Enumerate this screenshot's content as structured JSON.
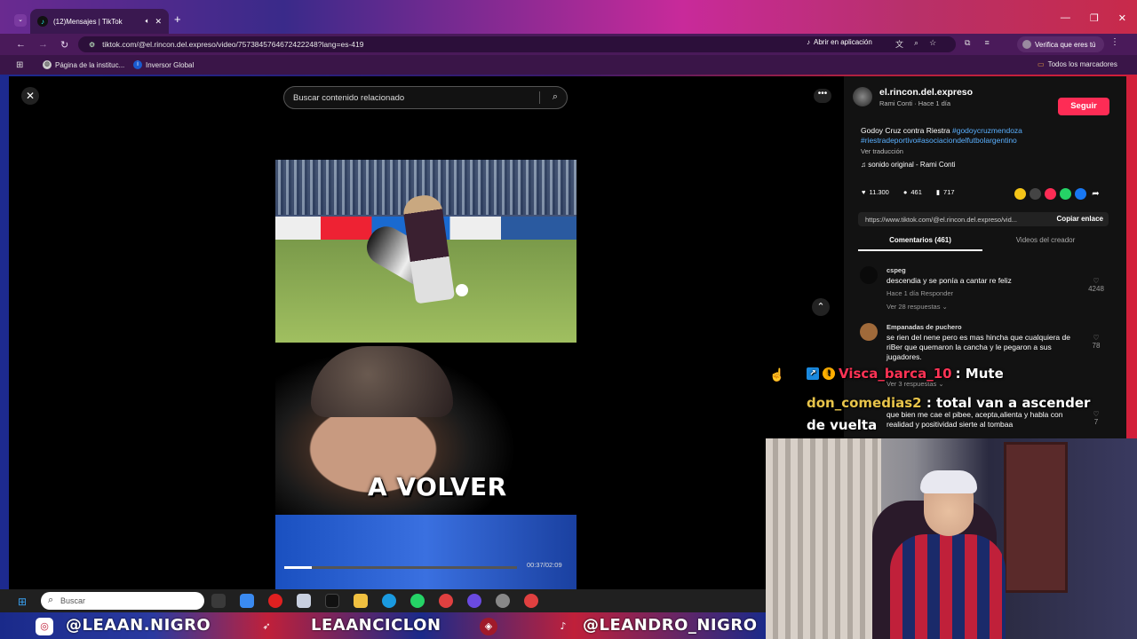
{
  "browser": {
    "tab_title": "(12)Mensajes | TikTok",
    "url": "tiktok.com/@el.rincon.del.expreso/video/7573845764672422248?lang=es-419",
    "open_in_app": "Abrir en aplicación",
    "verify": "Verifica que eres tú",
    "bookmarks": [
      "Página de la instituc...",
      "Inversor Global"
    ],
    "all_bookmarks": "Todos los marcadores"
  },
  "page": {
    "search_placeholder": "Buscar contenido relacionado",
    "video_caption": "A VOLVER",
    "video_time": "00:37/02:09",
    "video_progress": 0.12
  },
  "post": {
    "author": "el.rincon.del.expreso",
    "author_sub": "Rami Conti · Hace 1 día",
    "follow": "Seguir",
    "description_text": "Godoy Cruz contra Riestra ",
    "tags_line1": "#godoycruzmendoza",
    "tags_line2": "#riestradeportivo#asociaciondelfutbolargentino",
    "translate": "Ver traducción",
    "sound": "sonido original - Rami Conti",
    "likes": "11.300",
    "comments": "461",
    "saves": "717",
    "link": "https://www.tiktok.com/@el.rincon.del.expreso/vid...",
    "copy_link": "Copiar enlace",
    "tab_comments": "Comentarios (461)",
    "tab_creator": "Videos del creador"
  },
  "comments": [
    {
      "user": "cspeg",
      "text": "descendia y se ponía a cantar re feliz",
      "meta": "Hace 1 día    Responder",
      "replies": "Ver 28 respuestas ⌄",
      "likes": "4248"
    },
    {
      "user": "Empanadas de puchero",
      "text": "se rien del nene pero es mas hincha que cualquiera de riBer que quemaron la cancha y le pegaron a sus jugadores.",
      "replies": "Ver 3 respuestas ⌄",
      "likes": "78"
    },
    {
      "text": "que bien me cae el pibee, acepta,alienta y habla con realidad y positividad sierte al tombaa",
      "likes": "7"
    }
  ],
  "stream_chat": [
    {
      "user": "Visca_barca_10",
      "msg": ": Mute"
    },
    {
      "user": "don_comedias2",
      "msg": " : total van a ascender de vuelta"
    }
  ],
  "taskbar": {
    "search": "Buscar"
  },
  "banner": {
    "left": "@LEAAN.NIGRO",
    "center": "LEAANCICLON",
    "right": "@LEANDRO_NIGRO"
  },
  "colors": {
    "tiktok_red": "#fe2c55",
    "tag_blue": "#5ab0ff",
    "chat_user1": "#ff3355",
    "chat_user2": "#e8c44a"
  }
}
